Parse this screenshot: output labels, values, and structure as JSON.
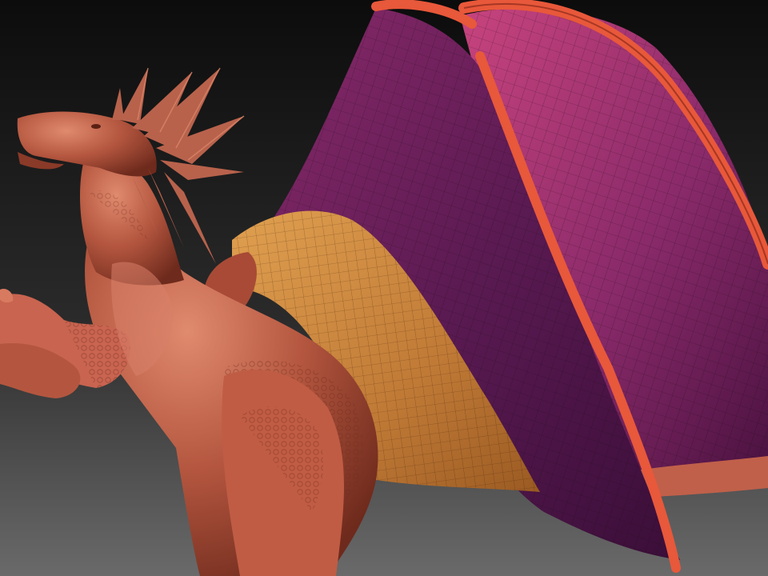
{
  "scene": {
    "subject": "dragon-sculpt",
    "colors": {
      "bg_top": "#0c0c0c",
      "bg_bottom": "#6a6a6a",
      "skin_light": "#d87a60",
      "skin_mid": "#b4563f",
      "skin_dark": "#6e2a1c",
      "membrane_dark": "#4a1240",
      "membrane_mid": "#8a2a6a",
      "membrane_light": "#c8447e",
      "inner_wing_light": "#e0a050",
      "inner_wing_dark": "#9a5a22",
      "bone_orange": "#e8583a",
      "wire": "#1a0a12"
    }
  }
}
